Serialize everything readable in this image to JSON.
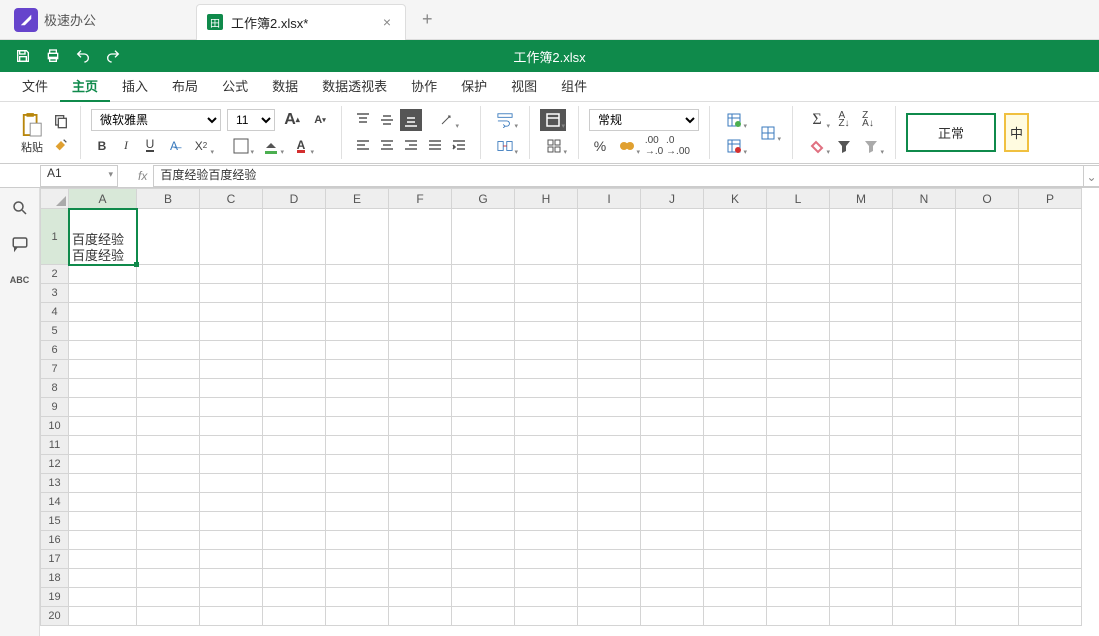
{
  "app": {
    "name": "极速办公"
  },
  "tab": {
    "name": "工作簿2.xlsx*",
    "icon": "田"
  },
  "document": {
    "title": "工作簿2.xlsx"
  },
  "menus": [
    "文件",
    "主页",
    "插入",
    "布局",
    "公式",
    "数据",
    "数据透视表",
    "协作",
    "保护",
    "视图",
    "组件"
  ],
  "active_menu_index": 1,
  "ribbon": {
    "paste_label": "粘贴",
    "font_name": "微软雅黑",
    "font_size": "11",
    "number_format": "常规",
    "style_normal": "正常",
    "style_medium": "中"
  },
  "formula_bar": {
    "name_box": "A1",
    "formula": "百度经验百度经验"
  },
  "side_abc": "ABC",
  "columns": [
    "A",
    "B",
    "C",
    "D",
    "E",
    "F",
    "G",
    "H",
    "I",
    "J",
    "K",
    "L",
    "M",
    "N",
    "O",
    "P"
  ],
  "rows": 20,
  "cells": {
    "A1": "百度经验百度经验"
  },
  "selected": "A1",
  "chart_data": null
}
